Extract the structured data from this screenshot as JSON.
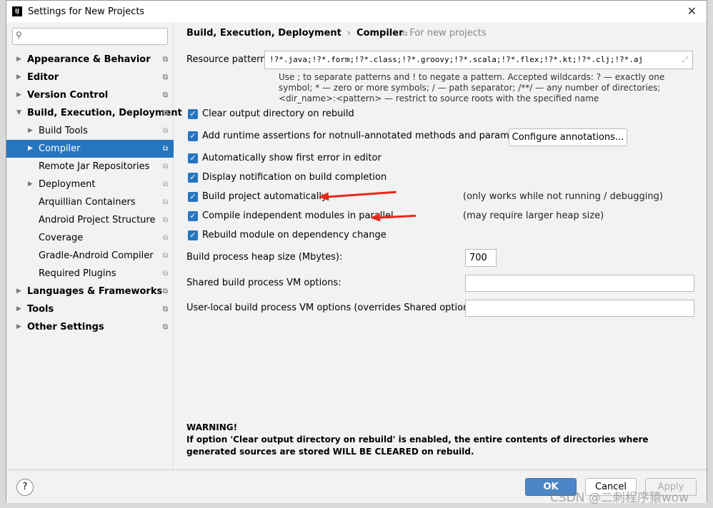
{
  "window": {
    "title": "Settings for New Projects",
    "app_icon": "intellij-icon",
    "close_icon": "close-icon"
  },
  "sidebar": {
    "search_placeholder": "",
    "items": [
      {
        "label": "Appearance & Behavior",
        "bold": true,
        "level": 0,
        "arrow": "▶"
      },
      {
        "label": "Editor",
        "bold": true,
        "level": 0,
        "arrow": "▶"
      },
      {
        "label": "Version Control",
        "bold": true,
        "level": 0,
        "arrow": "▶"
      },
      {
        "label": "Build, Execution, Deployment",
        "bold": true,
        "level": 0,
        "arrow": "▼"
      },
      {
        "label": "Build Tools",
        "level": 1,
        "arrow": "▶"
      },
      {
        "label": "Compiler",
        "level": 1,
        "arrow": "▶",
        "selected": true
      },
      {
        "label": "Remote Jar Repositories",
        "level": 1,
        "arrow": ""
      },
      {
        "label": "Deployment",
        "level": 1,
        "arrow": "▶"
      },
      {
        "label": "Arquillian Containers",
        "level": 1,
        "arrow": ""
      },
      {
        "label": "Android Project Structure",
        "level": 1,
        "arrow": ""
      },
      {
        "label": "Coverage",
        "level": 1,
        "arrow": ""
      },
      {
        "label": "Gradle-Android Compiler",
        "level": 1,
        "arrow": ""
      },
      {
        "label": "Required Plugins",
        "level": 1,
        "arrow": ""
      },
      {
        "label": "Languages & Frameworks",
        "bold": true,
        "level": 0,
        "arrow": "▶"
      },
      {
        "label": "Tools",
        "bold": true,
        "level": 0,
        "arrow": "▶"
      },
      {
        "label": "Other Settings",
        "bold": true,
        "level": 0,
        "arrow": "▶"
      }
    ]
  },
  "breadcrumb": {
    "parent": "Build, Execution, Deployment",
    "sep": "›",
    "current": "Compiler",
    "scope": "For new projects"
  },
  "resource": {
    "label": "Resource patterns:",
    "value": "!?*.java;!?*.form;!?*.class;!?*.groovy;!?*.scala;!?*.flex;!?*.kt;!?*.clj;!?*.aj",
    "help": "Use ; to separate patterns and ! to negate a pattern. Accepted wildcards: ? — exactly one symbol; * — zero or more symbols; / — path separator; /**/ — any number of directories; <dir_name>:<pattern> — restrict to source roots with the specified name"
  },
  "options": [
    {
      "label": "Clear output directory on rebuild",
      "checked": true
    },
    {
      "label": "Add runtime assertions for notnull-annotated methods and parameters",
      "checked": true
    },
    {
      "label": "Automatically show first error in editor",
      "checked": true
    },
    {
      "label": "Display notification on build completion",
      "checked": true
    },
    {
      "label": "Build project automatically",
      "checked": true,
      "note": "(only works while not running / debugging)"
    },
    {
      "label": "Compile independent modules in parallel",
      "checked": true,
      "note": "(may require larger heap size)"
    },
    {
      "label": "Rebuild module on dependency change",
      "checked": true
    }
  ],
  "configure_annotations": "Configure annotations...",
  "heap": {
    "label": "Build process heap size (Mbytes):",
    "value": "700"
  },
  "shared_vm": {
    "label": "Shared build process VM options:",
    "value": ""
  },
  "local_vm": {
    "label": "User-local build process VM options (overrides Shared options):",
    "value": ""
  },
  "warning": {
    "title": "WARNING!",
    "text": "If option 'Clear output directory on rebuild' is enabled, the entire contents of directories where generated sources are stored WILL BE CLEARED on rebuild."
  },
  "footer": {
    "help": "?",
    "ok": "OK",
    "cancel": "Cancel",
    "apply": "Apply"
  },
  "watermark": "CSDN @二刺程序猿wow",
  "colors": {
    "accent": "#2675bf",
    "annotation_arrow": "#e8261a"
  }
}
